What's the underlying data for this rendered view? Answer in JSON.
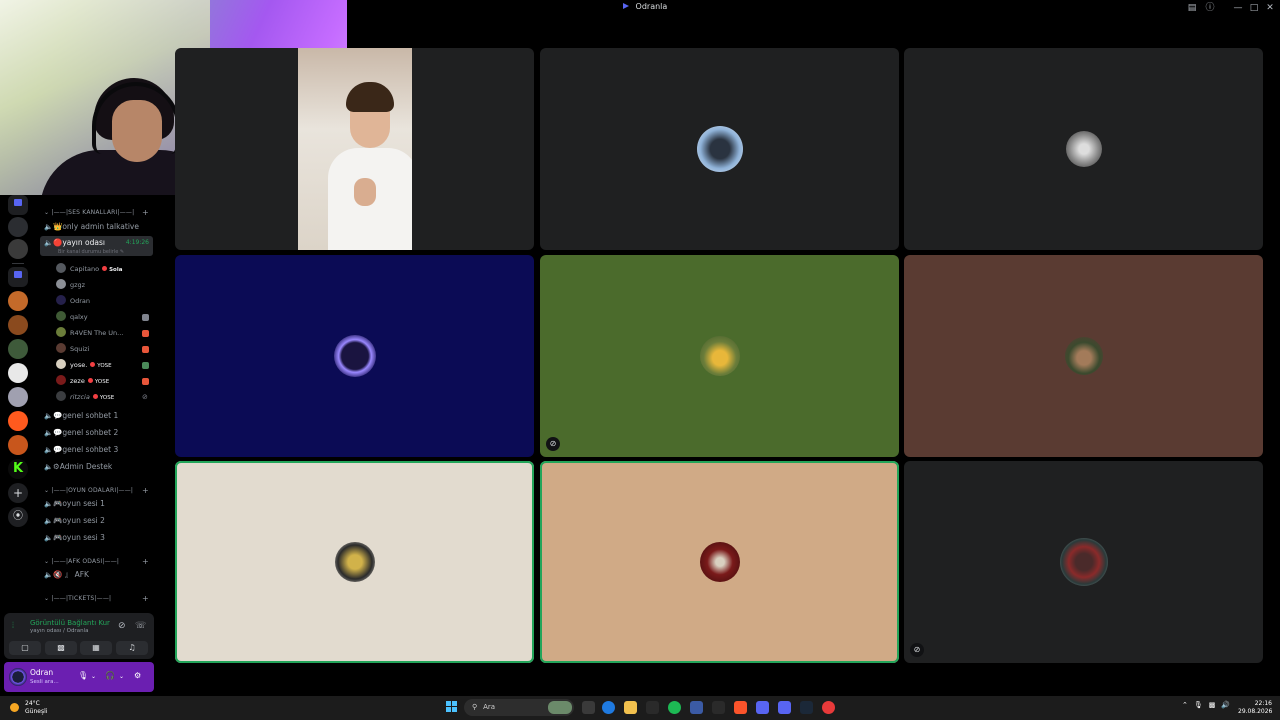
{
  "window": {
    "title": "Odranla"
  },
  "channels": {
    "categories": {
      "voice": "|——|SES KANALLARI|——|",
      "games": "|——|OYUN ODALARI|——|",
      "afk": "|——|AFK ODASI|——|",
      "tickets": "|——|TICKETS|——|"
    },
    "voice_list": [
      {
        "label": "👑only admin talkative"
      },
      {
        "label": "🔴yayın odası",
        "timer": "4:19:26",
        "sub": "Bir kanal durumu belirle ✎"
      },
      {
        "label": "💬genel sohbet 1"
      },
      {
        "label": "💬genel sohbet 2"
      },
      {
        "label": "💬genel sohbet 3"
      },
      {
        "label": "⚙Admin Destek"
      }
    ],
    "game_list": [
      {
        "label": "🎮oyun sesi 1"
      },
      {
        "label": "🎮oyun sesi 2"
      },
      {
        "label": "🎮oyun sesi 3"
      }
    ],
    "afk_list": [
      {
        "label": "🔇 』 AFK"
      }
    ],
    "members": [
      {
        "name": "Capitano",
        "tag": "Sola"
      },
      {
        "name": "gzgz",
        "tag": ""
      },
      {
        "name": "Odran",
        "tag": ""
      },
      {
        "name": "qalxy",
        "tag": ""
      },
      {
        "name": "R4VEN The Un...",
        "tag": ""
      },
      {
        "name": "Squizi",
        "tag": ""
      },
      {
        "name": "yose.",
        "tag": "YOSE"
      },
      {
        "name": "zeze",
        "tag": "YOSE"
      },
      {
        "name": "ritzcia",
        "tag": "YOSE"
      }
    ]
  },
  "voice_panel": {
    "status": "Görüntülü Bağlantı Kur",
    "location": "yayın odası / Odranla"
  },
  "user_panel": {
    "name": "Odran",
    "status": "Sesli ara..."
  },
  "taskbar": {
    "temperature": "24°C",
    "weather": "Güneşli",
    "search_placeholder": "Ara",
    "time": "22:16",
    "date": "29.08.2026"
  },
  "colors": {
    "tile_dark": "#1f2021",
    "tile_navy": "#0b0b55",
    "tile_green": "#4b6b2c",
    "tile_brown": "#5a3b32",
    "tile_cream": "#e2dbcf",
    "tile_tan": "#d0aa86",
    "speaking": "#23a55a",
    "accent": "#6b1fb1"
  }
}
